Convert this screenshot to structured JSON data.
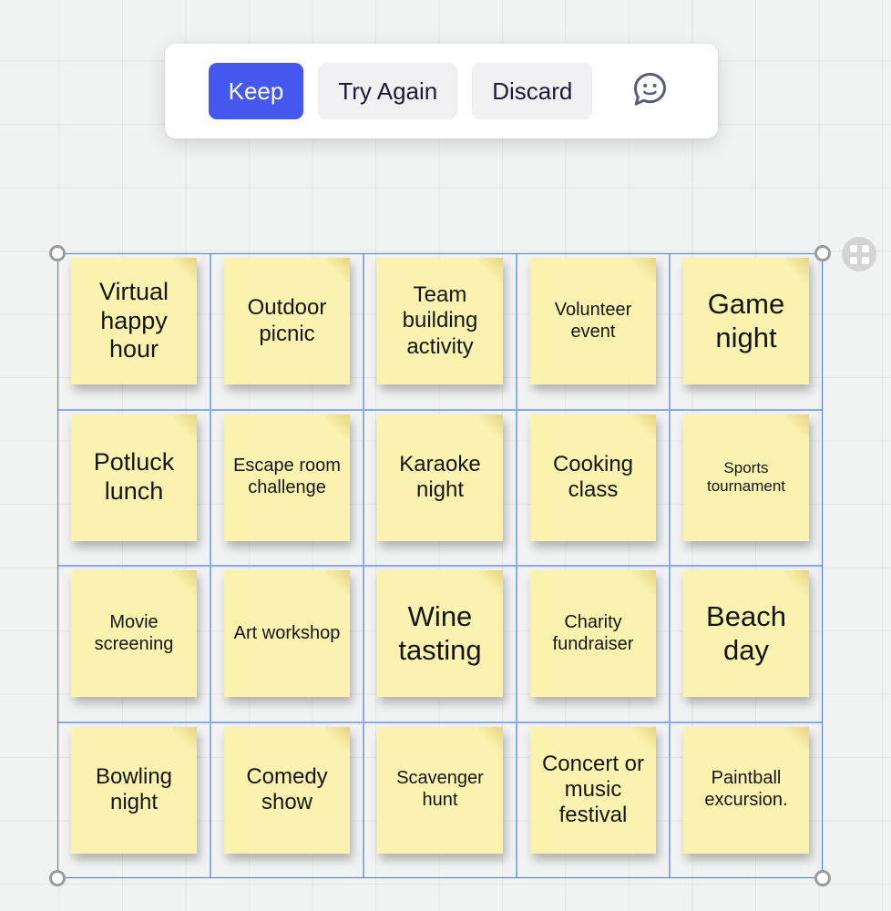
{
  "toolbar": {
    "keep_label": "Keep",
    "try_again_label": "Try Again",
    "discard_label": "Discard",
    "chat_icon": "speech-bubble-smiley-icon",
    "primary_color": "#4457ef",
    "secondary_bg": "#f0f0f2",
    "secondary_text": "#1c1b33"
  },
  "canvas": {
    "background_color": "#f1f2f2",
    "grid": "on",
    "selection_border_color": "#4a7ce8",
    "note_color": "#fbf2b0",
    "grab_handle_icon": "four-dots-grid-icon"
  },
  "notes": [
    {
      "text": "Virtual happy hour",
      "size": "fs-lg"
    },
    {
      "text": "Outdoor picnic",
      "size": "fs-md"
    },
    {
      "text": "Team building activity",
      "size": "fs-md"
    },
    {
      "text": "Volunteer event",
      "size": "fs-sm"
    },
    {
      "text": "Game night",
      "size": "fs-xl"
    },
    {
      "text": "Potluck lunch",
      "size": "fs-lg"
    },
    {
      "text": "Escape room challenge",
      "size": "fs-sm"
    },
    {
      "text": "Karaoke night",
      "size": "fs-md"
    },
    {
      "text": "Cooking class",
      "size": "fs-md"
    },
    {
      "text": "Sports tournament",
      "size": "fs-xs"
    },
    {
      "text": "Movie screening",
      "size": "fs-sm"
    },
    {
      "text": "Art workshop",
      "size": "fs-sm"
    },
    {
      "text": "Wine tasting",
      "size": "fs-xl"
    },
    {
      "text": "Charity fundraiser",
      "size": "fs-sm"
    },
    {
      "text": "Beach day",
      "size": "fs-xl"
    },
    {
      "text": "Bowling night",
      "size": "fs-md"
    },
    {
      "text": "Comedy show",
      "size": "fs-md"
    },
    {
      "text": "Scavenger hunt",
      "size": "fs-sm"
    },
    {
      "text": "Concert or music festival",
      "size": "fs-md"
    },
    {
      "text": "Paintball excursion.",
      "size": "fs-sm"
    }
  ]
}
